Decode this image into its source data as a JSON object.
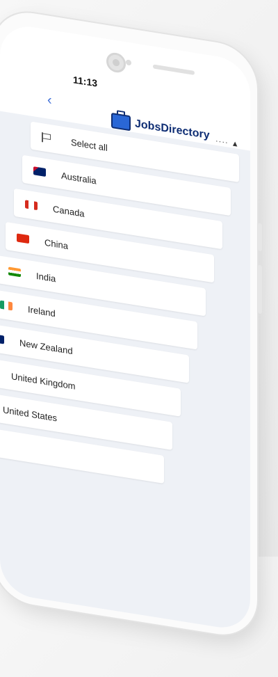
{
  "status": {
    "time": "11:13",
    "icons_text": "···· ▲ ▬"
  },
  "app": {
    "brand": "JobsDirectory",
    "back_label": "‹"
  },
  "list": {
    "select_all": "Select all",
    "countries": [
      {
        "name": "Australia",
        "flag_color": "#1d3c8f"
      },
      {
        "name": "Canada",
        "flag_color": "#d52b1e"
      },
      {
        "name": "China",
        "flag_color": "#de2910"
      },
      {
        "name": "India",
        "flag_color": "#ff9933"
      },
      {
        "name": "Ireland",
        "flag_color": "#169b62"
      },
      {
        "name": "New Zealand",
        "flag_color": "#012169"
      },
      {
        "name": "United Kingdom",
        "flag_color": "#012169"
      },
      {
        "name": "United States",
        "flag_color": "#b22234"
      }
    ]
  }
}
